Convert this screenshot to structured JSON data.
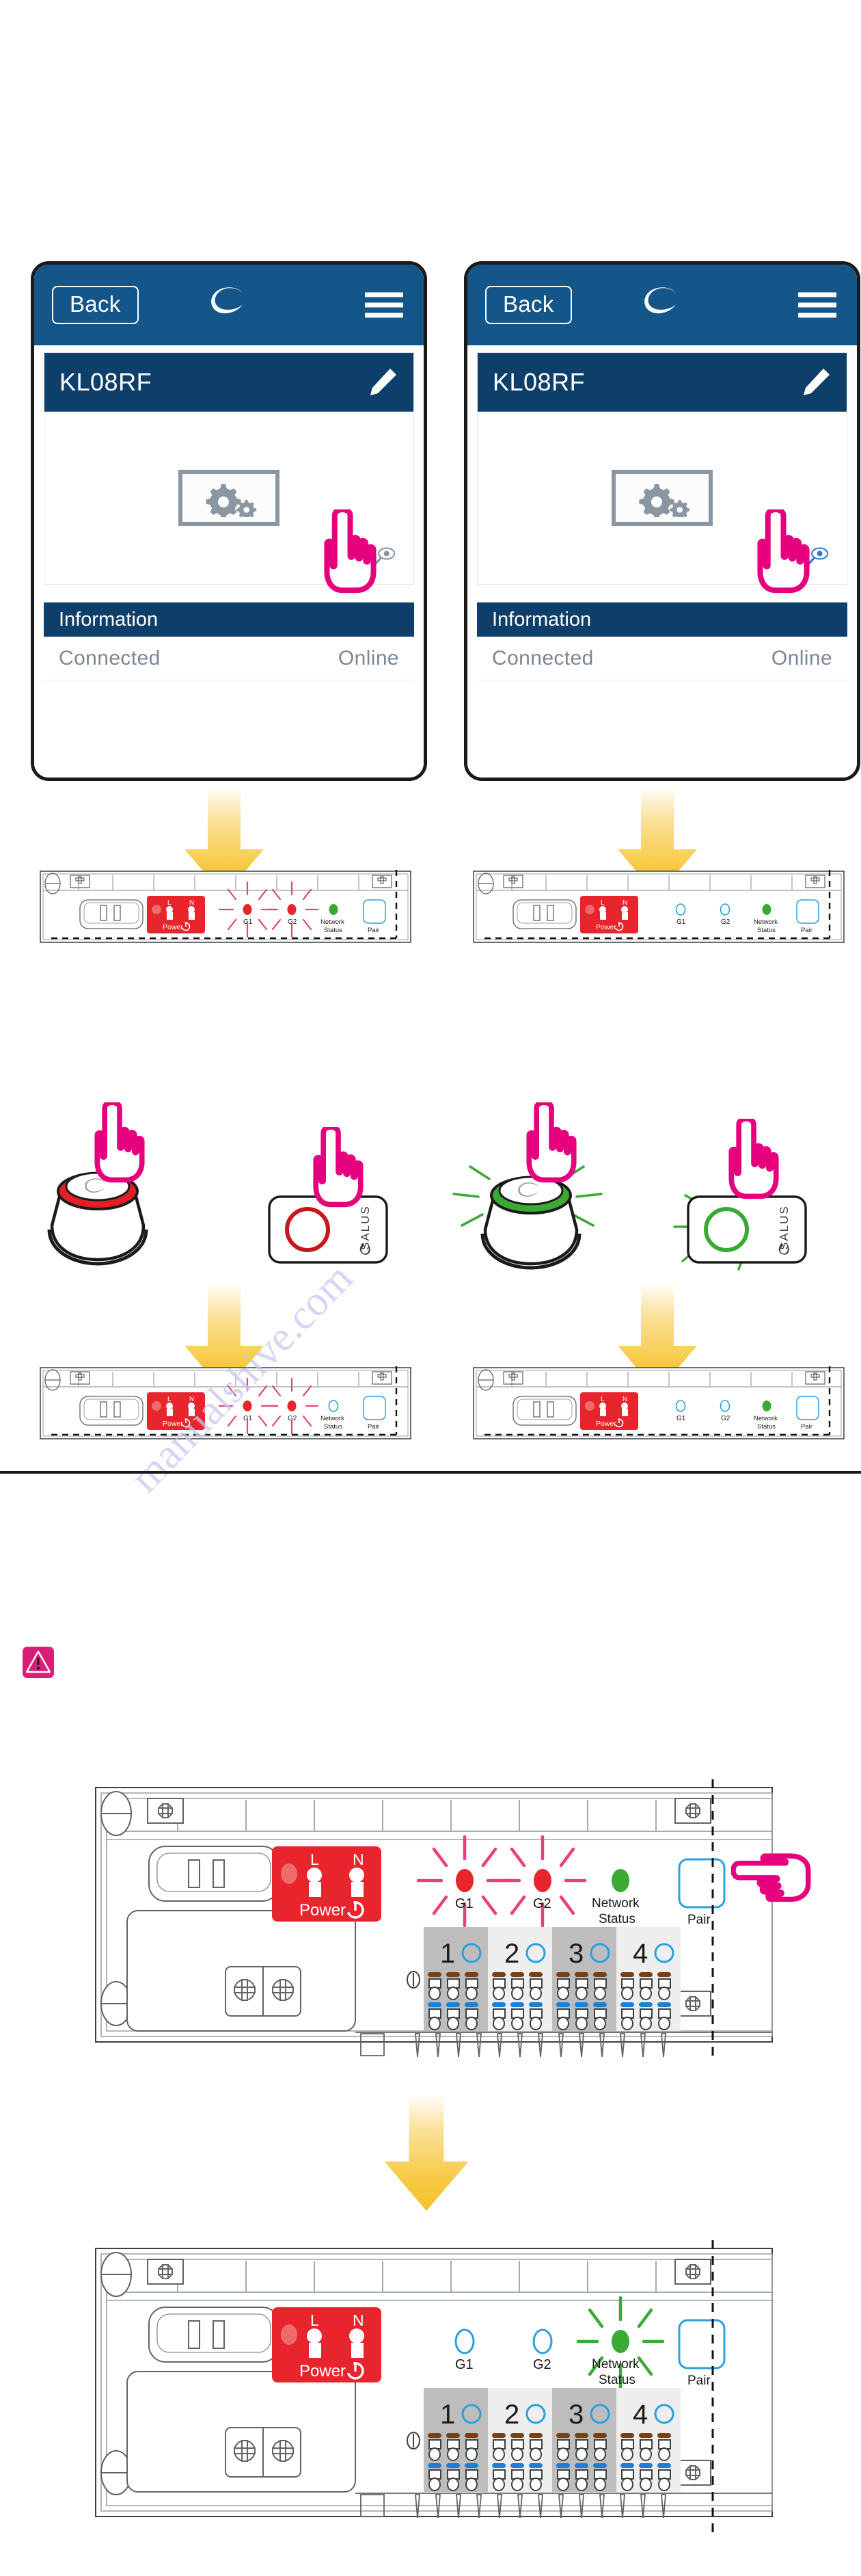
{
  "document": {
    "watermark": "manualshive.com"
  },
  "app_screens": [
    {
      "id": "screen-left",
      "back_label": "Back",
      "logo_name": "salus-logo",
      "menu_name": "hamburger-menu-icon",
      "device_name": "KL08RF",
      "edit_icon": "pencil-icon",
      "canvas_icon": "gears-image-placeholder-icon",
      "eye_icon": "eye-preview-icon",
      "eye_icon_color": "#8a97a3",
      "section_title": "Information",
      "status_label": "Connected",
      "status_value": "Online",
      "cursor": "pointing-hand-cursor"
    },
    {
      "id": "screen-right",
      "back_label": "Back",
      "logo_name": "salus-logo",
      "menu_name": "hamburger-menu-icon",
      "device_name": "KL08RF",
      "edit_icon": "pencil-icon",
      "canvas_icon": "gears-image-placeholder-icon",
      "eye_icon": "eye-preview-icon",
      "eye_icon_color": "#2b7fd4",
      "section_title": "Information",
      "status_label": "Connected",
      "status_value": "Online",
      "cursor": "pointing-hand-cursor"
    }
  ],
  "controllers": [
    {
      "id": "ctrl-top-left",
      "power_label": "Power",
      "terminal_l": "L",
      "terminal_n": "N",
      "led_g1_label": "G1",
      "led_g2_label": "G2",
      "led_network_label_1": "Network",
      "led_network_label_2": "Status",
      "pair_label": "Pair",
      "g1_state": "blinking-red",
      "g2_state": "blinking-red",
      "network_state": "solid-green"
    },
    {
      "id": "ctrl-top-right",
      "power_label": "Power",
      "terminal_l": "L",
      "terminal_n": "N",
      "led_g1_label": "G1",
      "led_g2_label": "G2",
      "led_network_label_1": "Network",
      "led_network_label_2": "Status",
      "pair_label": "Pair",
      "g1_state": "off",
      "g2_state": "off",
      "network_state": "solid-green"
    },
    {
      "id": "ctrl-mid-left",
      "power_label": "Power",
      "terminal_l": "L",
      "terminal_n": "N",
      "led_g1_label": "G1",
      "led_g2_label": "G2",
      "led_network_label_1": "Network",
      "led_network_label_2": "Status",
      "pair_label": "Pair",
      "g1_state": "blinking-red",
      "g2_state": "blinking-red",
      "network_state": "solid-green"
    },
    {
      "id": "ctrl-mid-right",
      "power_label": "Power",
      "terminal_l": "L",
      "terminal_n": "N",
      "led_g1_label": "G1",
      "led_g2_label": "G2",
      "led_network_label_1": "Network",
      "led_network_label_2": "Status",
      "pair_label": "Pair",
      "g1_state": "off",
      "g2_state": "off",
      "network_state": "solid-green"
    }
  ],
  "thermostat_devices": [
    {
      "id": "round-thermostat-red",
      "name": "round-thermostat",
      "ring_color": "#e31e24",
      "glow": "none",
      "cursor": "pointing-hand-cursor"
    },
    {
      "id": "flat-thermostat-red",
      "name": "flat-thermostat",
      "brand": "SALUS",
      "ring_color": "#c8161d",
      "glow": "none",
      "cursor": "pointing-hand-cursor"
    },
    {
      "id": "round-thermostat-green",
      "name": "round-thermostat",
      "ring_color": "#3aaa35",
      "glow": "green",
      "cursor": "pointing-hand-cursor"
    },
    {
      "id": "flat-thermostat-green",
      "name": "flat-thermostat",
      "brand": "SALUS",
      "ring_color": "#3aaa35",
      "glow": "green",
      "cursor": "pointing-hand-cursor"
    }
  ],
  "warning": {
    "icon": "warning-triangle-icon",
    "color": "#d81e78"
  },
  "device_panels": [
    {
      "id": "panel-top",
      "power_label": "Power",
      "terminal_l": "L",
      "terminal_n": "N",
      "led_g1_label": "G1",
      "led_g2_label": "G2",
      "led_network_label_1": "Network",
      "led_network_label_2": "Status",
      "pair_label": "Pair",
      "g1_state": "blinking-red",
      "g2_state": "blinking-red",
      "network_state": "solid-green",
      "pair_cursor": "pointing-hand-cursor",
      "zones": [
        "1",
        "2",
        "3",
        "4"
      ]
    },
    {
      "id": "panel-bottom",
      "power_label": "Power",
      "terminal_l": "L",
      "terminal_n": "N",
      "led_g1_label": "G1",
      "led_g2_label": "G2",
      "led_network_label_1": "Network",
      "led_network_label_2": "Status",
      "pair_label": "Pair",
      "g1_state": "off",
      "g2_state": "off",
      "network_state": "blinking-green",
      "pair_cursor": "none",
      "zones": [
        "1",
        "2",
        "3",
        "4"
      ]
    }
  ],
  "arrows": [
    {
      "id": "arrow-1",
      "direction": "down",
      "color": "#f6c544"
    },
    {
      "id": "arrow-2",
      "direction": "down",
      "color": "#f6c544"
    },
    {
      "id": "arrow-3",
      "direction": "down",
      "color": "#f6c544"
    },
    {
      "id": "arrow-4",
      "direction": "down",
      "color": "#f6c544"
    },
    {
      "id": "arrow-5",
      "direction": "down",
      "color": "#f6c544"
    }
  ]
}
